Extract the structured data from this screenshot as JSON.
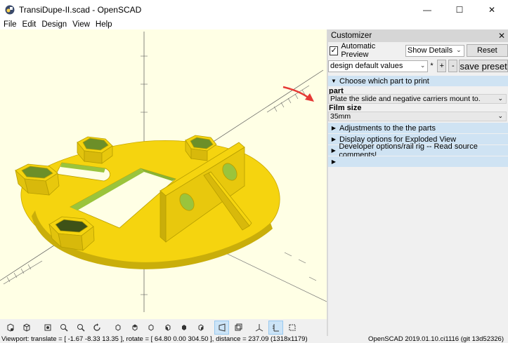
{
  "window": {
    "title": "TransiDupe-II.scad - OpenSCAD",
    "minimize": "—",
    "maximize": "☐",
    "close": "✕"
  },
  "menu": [
    "File",
    "Edit",
    "Design",
    "View",
    "Help"
  ],
  "customizer": {
    "title": "Customizer",
    "close": "✕",
    "automatic_preview_label": "Automatic Preview",
    "automatic_preview_checked": true,
    "details_select": "Show Details",
    "reset_label": "Reset",
    "preset_select": "design default values",
    "preset_modified_marker": "*",
    "add_label": "+",
    "remove_label": "-",
    "save_preset_label": "save preset",
    "groups": [
      {
        "label": "Choose which part to print",
        "expanded": true
      },
      {
        "label": "Adjustments to the the parts",
        "expanded": false
      },
      {
        "label": "Display options for Exploded View",
        "expanded": false
      },
      {
        "label": "Developer options/rail rig -- Read source comments!",
        "expanded": false
      },
      {
        "label": "",
        "expanded": false
      }
    ],
    "params": [
      {
        "label": "part",
        "value": "Plate the slide and negative carriers mount to."
      },
      {
        "label": "Film size",
        "value": "35mm"
      }
    ]
  },
  "toolbar_icons": [
    "preview-icon",
    "render-icon",
    "view-all-icon",
    "zoom-in-icon",
    "zoom-out-icon",
    "reset-view-icon",
    "view-right-icon",
    "view-top-icon",
    "view-bottom-icon",
    "view-left-icon",
    "view-front-icon",
    "view-back-icon",
    "perspective-icon",
    "orthogonal-icon",
    "show-axes-icon",
    "show-scale-markers-icon",
    "show-edges-icon"
  ],
  "status": {
    "viewport": "Viewport: translate = [ -1.67 -8.33 13.35 ], rotate = [ 64.80 0.00 304.50 ], distance = 237.09 (1318x1179)",
    "version": "OpenSCAD 2019.01.10.ci1116 (git 13d52326)"
  },
  "colors": {
    "viewport_bg": "#ffffe5",
    "model_yellow": "#f5d40f",
    "model_green": "#9ac43c",
    "highlight_blue": "#cfe3f3",
    "annotation_arrow": "#e53935"
  }
}
